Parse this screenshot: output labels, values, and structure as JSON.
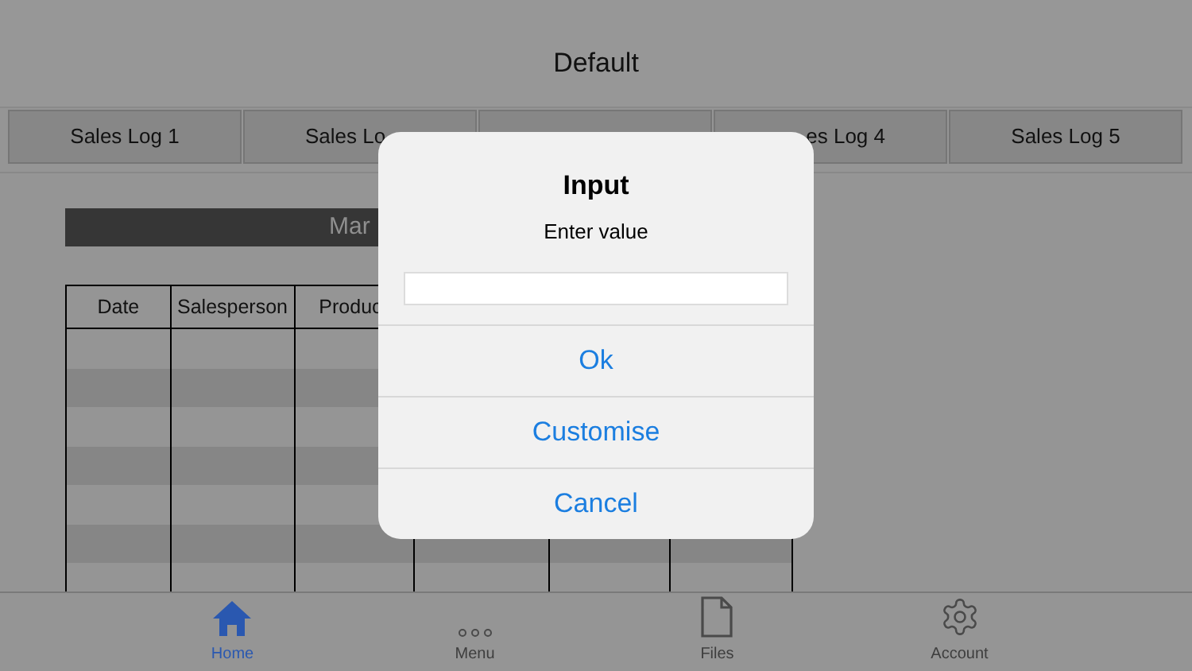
{
  "header": {
    "title": "Default"
  },
  "tabs": [
    {
      "label": "Sales Log 1"
    },
    {
      "label": "Sales Lo"
    },
    {
      "label": "es Log 4"
    },
    {
      "label": "Sales Log 5"
    }
  ],
  "banner": {
    "title": "Mar"
  },
  "table": {
    "columns": [
      "Date",
      "Salesperson",
      "Produc"
    ]
  },
  "dialog": {
    "title": "Input",
    "message": "Enter value",
    "buttons": [
      "Ok",
      "Customise",
      "Cancel"
    ]
  },
  "bottom_bar": [
    {
      "label": "Home",
      "selected": true
    },
    {
      "label": "Menu",
      "selected": false
    },
    {
      "label": "Files",
      "selected": false
    },
    {
      "label": "Account",
      "selected": false
    }
  ]
}
